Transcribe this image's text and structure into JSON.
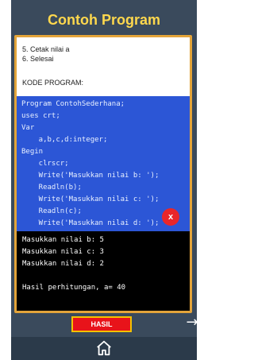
{
  "header": {
    "title": "Contoh Program"
  },
  "steps": [
    "5. Cetak nilai a",
    "6. Selesai"
  ],
  "code_heading": "KODE PROGRAM:",
  "code_lines": [
    "Program ContohSederhana;",
    "uses crt;",
    "Var",
    "    a,b,c,d:integer;",
    "Begin",
    "    clrscr;",
    "    Write('Masukkan nilai b: ');",
    "    Readln(b);",
    "    Write('Masukkan nilai c: ');",
    "    Readln(c);",
    "    Write('Masukkan nilai d: ');"
  ],
  "close_label": "x",
  "output_lines": [
    "Masukkan nilai b: 5",
    "Masukkan nilai c: 3",
    "Masukkan nilai d: 2",
    "",
    "Hasil perhitungan, a= 40"
  ],
  "buttons": {
    "hasil_label": "HASIL",
    "next_arrow": "→"
  },
  "icons": {
    "home": "home-icon",
    "close": "close-icon",
    "next": "arrow-right-icon"
  }
}
